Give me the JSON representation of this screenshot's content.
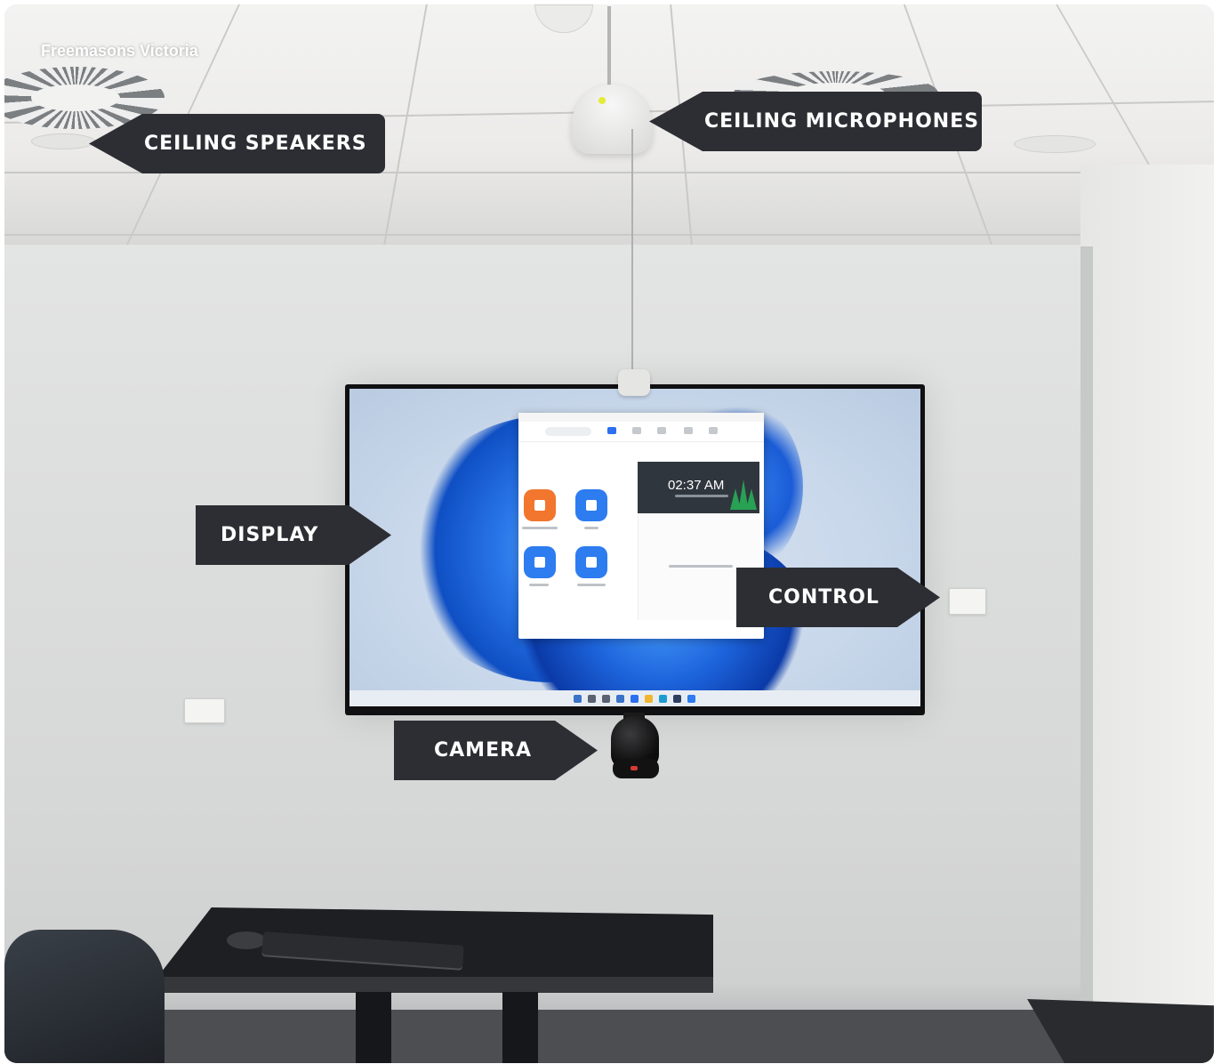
{
  "watermark": "Freemasons Victoria",
  "labels": {
    "ceiling_speakers": "CEILING SPEAKERS",
    "ceiling_microphones": "CEILING MICROPHONES",
    "display": "DISPLAY",
    "control": "CONTROL",
    "camera": "CAMERA"
  },
  "screen": {
    "clock": "02:37 AM"
  },
  "colors": {
    "callout_bg": "#2d2e33",
    "callout_text": "#ffffff",
    "zoom_blue": "#2d7cf0",
    "zoom_orange": "#f2762e",
    "wallpaper_blue": "#1f64d8"
  }
}
